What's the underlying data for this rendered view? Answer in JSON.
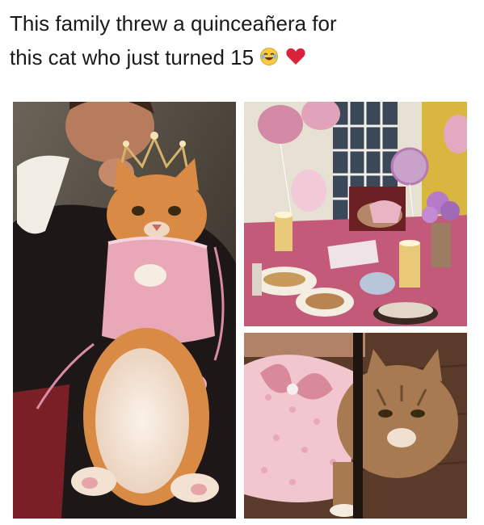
{
  "caption": {
    "line1": "This family threw a quinceañera for",
    "line2": "this cat who just turned 15",
    "emoji_1": "crying-laughing-face-icon",
    "emoji_2": "red-heart-icon"
  },
  "photos": [
    {
      "name": "woman-holding-cat-in-tiara-photo"
    },
    {
      "name": "party-table-with-balloons-photo"
    },
    {
      "name": "cat-in-pink-dress-under-chair-photo"
    }
  ],
  "colors": {
    "text": "#1a1a1a",
    "cat_orange": "#d98a45",
    "dress_pink": "#e9a8b8",
    "tablecloth": "#c45a7a",
    "heart": "#d9233b"
  }
}
